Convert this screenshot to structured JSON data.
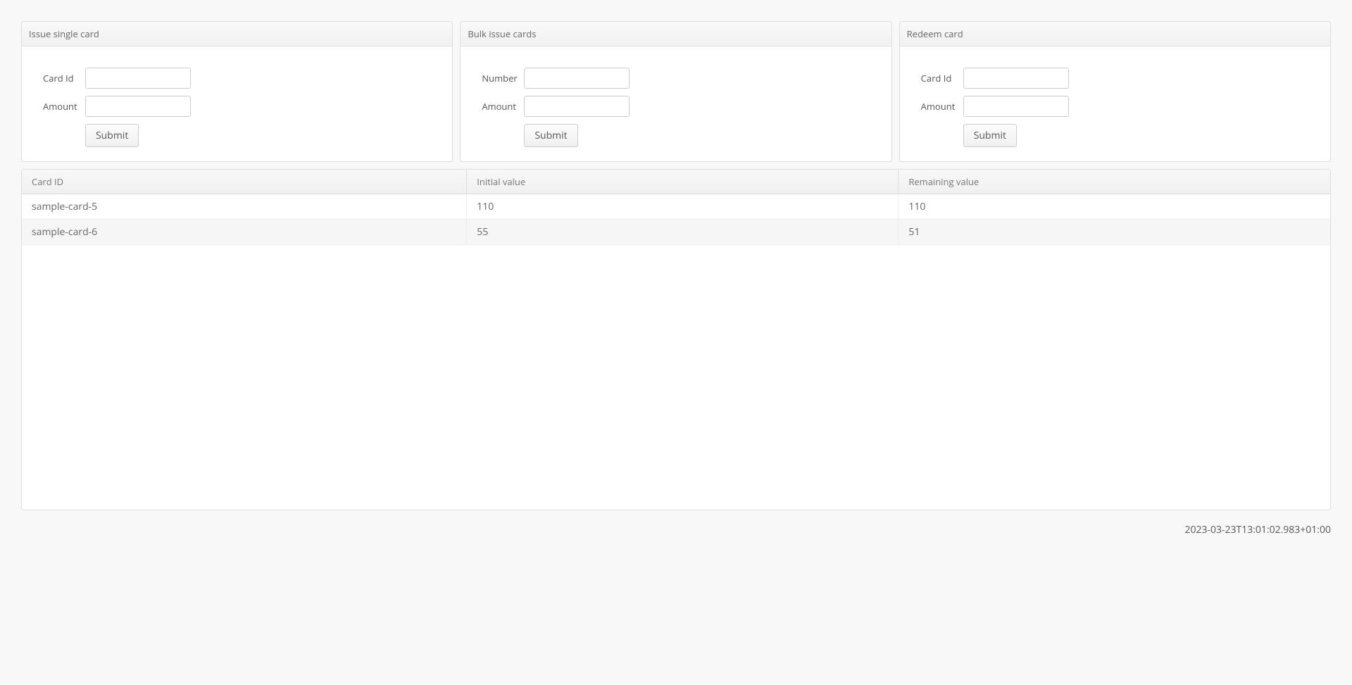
{
  "panels": {
    "issueSingle": {
      "title": "Issue single card",
      "cardIdLabel": "Card Id",
      "amountLabel": "Amount",
      "submitLabel": "Submit"
    },
    "bulkIssue": {
      "title": "Bulk issue cards",
      "numberLabel": "Number",
      "amountLabel": "Amount",
      "submitLabel": "Submit"
    },
    "redeem": {
      "title": "Redeem card",
      "cardIdLabel": "Card Id",
      "amountLabel": "Amount",
      "submitLabel": "Submit"
    }
  },
  "table": {
    "headers": {
      "cardId": "Card ID",
      "initialValue": "Initial value",
      "remainingValue": "Remaining value"
    },
    "rows": [
      {
        "cardId": "sample-card-5",
        "initialValue": "110",
        "remainingValue": "110"
      },
      {
        "cardId": "sample-card-6",
        "initialValue": "55",
        "remainingValue": "51"
      }
    ]
  },
  "timestamp": "2023-03-23T13:01:02.983+01:00"
}
